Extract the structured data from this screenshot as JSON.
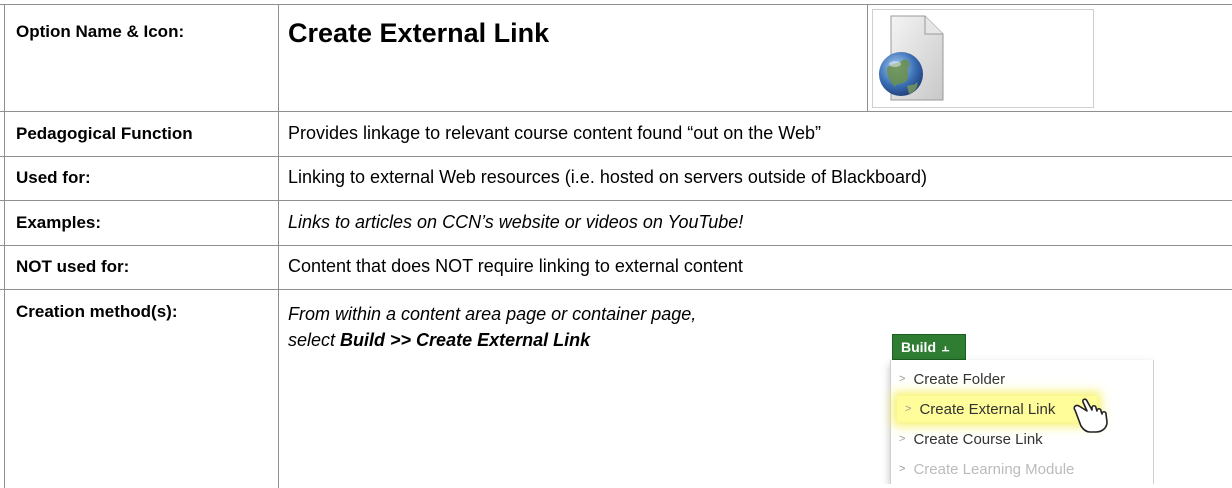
{
  "header": {
    "label": "Option Name & Icon:",
    "title": "Create External Link",
    "icon": "globe-document-icon"
  },
  "rows": [
    {
      "label": "Pedagogical Function",
      "value": "Provides linkage to relevant course content found “out on the Web”",
      "italic": false
    },
    {
      "label": "Used for:",
      "value": "Linking to external Web resources (i.e. hosted on servers outside of Blackboard)",
      "italic": false
    },
    {
      "label": "Examples:",
      "value": "Links to articles on CCN’s website or videos on YouTube!",
      "italic": true
    },
    {
      "label": "NOT used for:",
      "value": "Content that does NOT require linking to external content",
      "italic": false
    }
  ],
  "creation": {
    "label": "Creation method(s):",
    "line1": "From within a content area page or container page,",
    "line2_prefix": "select ",
    "line2_bold": "Build >> Create External Link"
  },
  "build_menu": {
    "button_label": "Build",
    "button_color": "#2e7d32",
    "highlight_color": "#fffc9a",
    "items": [
      {
        "label": "Create Folder",
        "state": "normal"
      },
      {
        "label": "Create External Link",
        "state": "highlighted"
      },
      {
        "label": "Create Course Link",
        "state": "normal"
      },
      {
        "label": "Create Learning Module",
        "state": "faded"
      }
    ],
    "cursor_icon": "hand-pointer-icon"
  }
}
